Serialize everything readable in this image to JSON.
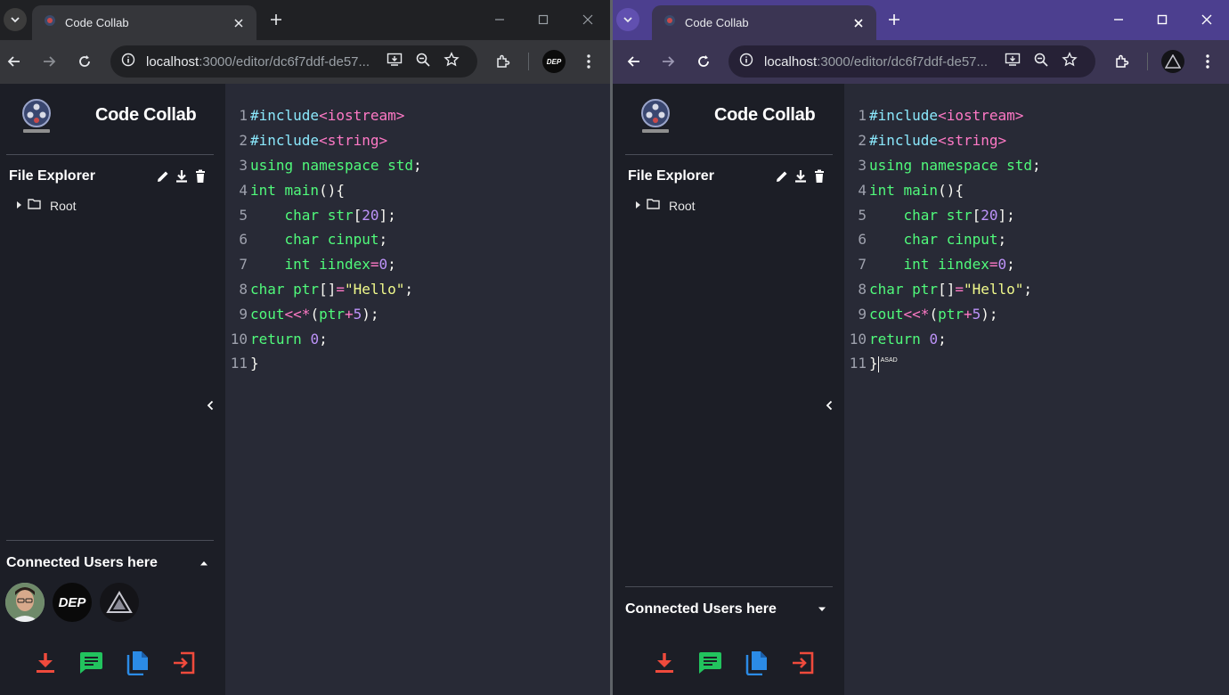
{
  "left_window": {
    "tab_title": "Code Collab",
    "url_host": "localhost",
    "url_rest": ":3000/editor/dc6f7ddf-de57...",
    "profile_text": "DEP",
    "brand": "Code Collab",
    "file_explorer_title": "File Explorer",
    "root_label": "Root",
    "connected_users_title": "Connected Users here",
    "connected_users_expanded": true,
    "avatars": [
      {
        "name": "user-photo-avatar",
        "label": ""
      },
      {
        "name": "dep-avatar",
        "label": "DEP"
      },
      {
        "name": "triangle-logo-avatar",
        "label": ""
      }
    ]
  },
  "right_window": {
    "tab_title": "Code Collab",
    "url_host": "localhost",
    "url_rest": ":3000/editor/dc6f7ddf-de57...",
    "brand": "Code Collab",
    "file_explorer_title": "File Explorer",
    "root_label": "Root",
    "connected_users_title": "Connected Users here",
    "connected_users_expanded": false,
    "cursor_label": "ASAD"
  },
  "code_lines": [
    {
      "n": "1",
      "tokens": [
        [
          "c-pre",
          "#include"
        ],
        [
          "c-inc",
          "<iostream>"
        ]
      ]
    },
    {
      "n": "2",
      "tokens": [
        [
          "c-pre",
          "#include"
        ],
        [
          "c-inc",
          "<string>"
        ]
      ]
    },
    {
      "n": "3",
      "tokens": [
        [
          "c-kw",
          "using namespace std"
        ],
        [
          "ct",
          ";"
        ]
      ]
    },
    {
      "n": "4",
      "tokens": [
        [
          "c-kw",
          "int main"
        ],
        [
          "ct",
          "(){"
        ]
      ]
    },
    {
      "n": "5",
      "tokens": [
        [
          "ct",
          "    "
        ],
        [
          "c-kw",
          "char str"
        ],
        [
          "ct",
          "["
        ],
        [
          "c-num",
          "20"
        ],
        [
          "ct",
          "];"
        ]
      ]
    },
    {
      "n": "6",
      "tokens": [
        [
          "ct",
          "    "
        ],
        [
          "c-kw",
          "char cinput"
        ],
        [
          "ct",
          ";"
        ]
      ]
    },
    {
      "n": "7",
      "tokens": [
        [
          "ct",
          "    "
        ],
        [
          "c-kw",
          "int iindex"
        ],
        [
          "c-op",
          "="
        ],
        [
          "c-num",
          "0"
        ],
        [
          "ct",
          ";"
        ]
      ]
    },
    {
      "n": "8",
      "tokens": [
        [
          "c-kw",
          "char ptr"
        ],
        [
          "ct",
          "[]"
        ],
        [
          "c-op",
          "="
        ],
        [
          "c-str",
          "\"Hello\""
        ],
        [
          "ct",
          ";"
        ]
      ]
    },
    {
      "n": "9",
      "tokens": [
        [
          "c-kw",
          "cout"
        ],
        [
          "c-op",
          "<<*"
        ],
        [
          "ct",
          "("
        ],
        [
          "c-kw",
          "ptr"
        ],
        [
          "c-op",
          "+"
        ],
        [
          "c-num",
          "5"
        ],
        [
          "ct",
          ");"
        ]
      ]
    },
    {
      "n": "10",
      "tokens": [
        [
          "c-kw",
          "return "
        ],
        [
          "c-num",
          "0"
        ],
        [
          "ct",
          ";"
        ]
      ]
    },
    {
      "n": "11",
      "tokens": [
        [
          "ct",
          "}"
        ]
      ]
    }
  ],
  "colors": {
    "download_red": "#ef4a3c",
    "chat_green": "#22c35e",
    "copy_blue": "#2b8be6",
    "leave_red": "#ef4a3c",
    "editor_bg": "#282a36",
    "sidebar_bg": "#1c1e26"
  }
}
